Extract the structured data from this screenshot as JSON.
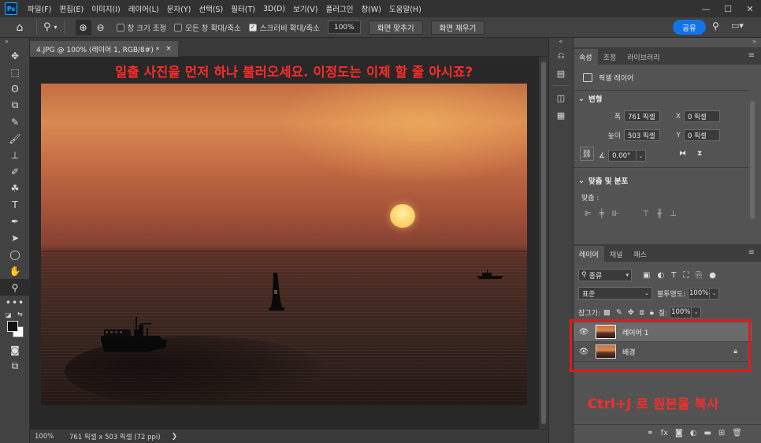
{
  "menu": {
    "logo": "Ps",
    "items": [
      "파일(F)",
      "편집(E)",
      "이미지(I)",
      "레이어(L)",
      "문자(Y)",
      "선택(S)",
      "필터(T)",
      "3D(D)",
      "보기(V)",
      "플러그인",
      "창(W)",
      "도움말(H)"
    ],
    "window_controls": {
      "minimize": "—",
      "maximize": "☐",
      "close": "✕"
    }
  },
  "options": {
    "home_icon": "⌂",
    "tool_icon": "⚲",
    "checkbox_resize_window": "창 크기 조정",
    "checkbox_zoom_all": "모든 창 확대/축소",
    "checkbox_scrubby": "스크러비 확대/축소",
    "zoom_value": "100%",
    "fit_screen": "화면 맞추기",
    "fill_screen": "화면 채우기",
    "share": "공유"
  },
  "toolbar": {
    "tools": [
      "✥",
      "⬚",
      "ʘ",
      "⧉",
      "✎",
      "🖌",
      "⊥",
      "✐",
      "☘",
      "T",
      "✒",
      "➤",
      "◯",
      "✋",
      "⚲"
    ],
    "more": "•••"
  },
  "document": {
    "tab_title": "4.JPG @ 100% (레이어 1, RGB/8#) *",
    "tab_close": "×",
    "status_zoom": "100%",
    "status_info": "761 픽셀 x 503 픽셀 (72 ppi)",
    "status_arrow": "❯"
  },
  "annotations": {
    "top": "일출 사진을 먼저 하나 불러오세요. 이정도는 이제 할 줄 아시죠?",
    "bottom": "Ctrl+J 로 원본을 복사"
  },
  "properties_panel": {
    "tabs": [
      "속성",
      "조정",
      "라이브러리"
    ],
    "active_tab": 0,
    "layer_kind": "픽셀 레이어",
    "transform_header": "변형",
    "width_label": "폭",
    "width_value": "761 픽셀",
    "height_label": "높이",
    "height_value": "503 픽셀",
    "x_label": "X",
    "x_value": "0 픽셀",
    "y_label": "Y",
    "y_value": "0 픽셀",
    "angle_value": "0.00°",
    "align_header": "맞춤 및 분포",
    "align_label": "맞춤 :"
  },
  "layers_panel": {
    "tabs": [
      "레이어",
      "채널",
      "패스"
    ],
    "active_tab": 0,
    "kind_filter": "종류",
    "blend_mode": "표준",
    "opacity_label": "불투명도:",
    "opacity_value": "100%",
    "lock_label": "잠그기:",
    "fill_label": "칠:",
    "fill_value": "100%",
    "layers": [
      {
        "name": "레이어 1",
        "selected": true,
        "locked": false
      },
      {
        "name": "배경",
        "selected": false,
        "locked": true
      }
    ]
  },
  "colors": {
    "annotation": "#ff2b2b",
    "share_button": "#1473e6",
    "highlight_box": "#e01b1b"
  }
}
